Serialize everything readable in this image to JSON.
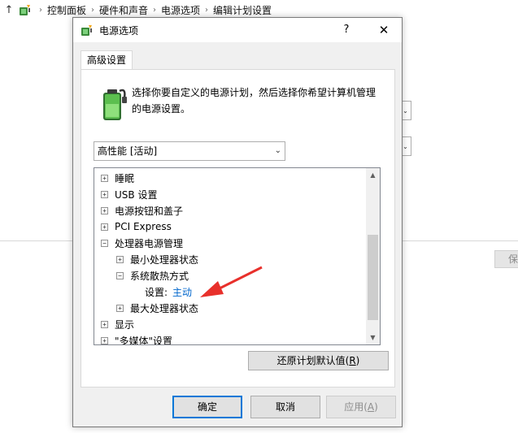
{
  "breadcrumb": {
    "up_glyph": "↑",
    "items": [
      "控制面板",
      "硬件和声音",
      "电源选项",
      "编辑计划设置"
    ]
  },
  "background": {
    "partial_button_label": "保"
  },
  "dialog": {
    "title": "电源选项",
    "help_label": "?",
    "close_label": "✕",
    "tab_label": "高级设置",
    "description": "选择你要自定义的电源计划，然后选择你希望计算机管理的电源设置。",
    "plan_select": {
      "selected": "高性能 [活动]"
    },
    "tree": [
      {
        "label": "睡眠",
        "toggle": "+",
        "level": 0
      },
      {
        "label": "USB 设置",
        "toggle": "+",
        "level": 0
      },
      {
        "label": "电源按钮和盖子",
        "toggle": "+",
        "level": 0
      },
      {
        "label": "PCI Express",
        "toggle": "+",
        "level": 0
      },
      {
        "label": "处理器电源管理",
        "toggle": "−",
        "level": 0
      },
      {
        "label": "最小处理器状态",
        "toggle": "+",
        "level": 1
      },
      {
        "label": "系统散热方式",
        "toggle": "−",
        "level": 1
      },
      {
        "label": "设置:",
        "value": "主动",
        "level": 2
      },
      {
        "label": "最大处理器状态",
        "toggle": "+",
        "level": 1
      },
      {
        "label": "显示",
        "toggle": "+",
        "level": 0
      },
      {
        "label": "\"多媒体\"设置",
        "toggle": "+",
        "level": 0
      }
    ],
    "restore_button": {
      "text": "还原计划默认值(",
      "key": "R",
      "suffix": ")"
    },
    "ok_label": "确定",
    "cancel_label": "取消",
    "apply_button": {
      "text": "应用(",
      "key": "A",
      "suffix": ")"
    }
  },
  "colors": {
    "accent": "#0078d7",
    "setting_value": "#0066cc",
    "annotation_arrow": "#e8302b"
  },
  "icons": {
    "breadcrumb": "power-options-icon",
    "title": "power-options-icon",
    "description": "battery-power-icon"
  }
}
